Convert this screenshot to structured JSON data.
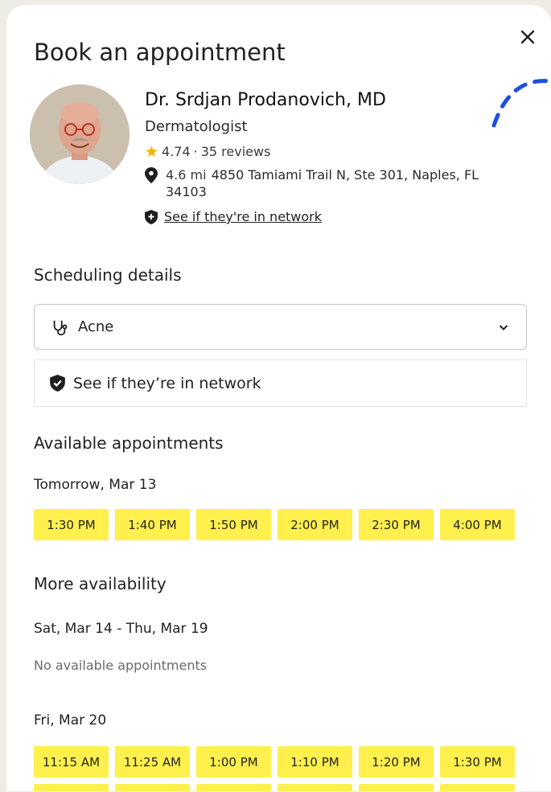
{
  "modal": {
    "title": "Book an appointment"
  },
  "doctor": {
    "name": "Dr. Srdjan Prodanovich, MD",
    "specialty": "Dermatologist",
    "rating": "4.74",
    "reviews": "35 reviews",
    "distance": "4.6 mi",
    "address": "4850 Tamiami Trail N, Ste 301, Naples, FL 34103",
    "network_link": "See if they're in network"
  },
  "scheduling": {
    "heading": "Scheduling details",
    "reason_value": "Acne",
    "network_box": "See if they’re in network"
  },
  "appointments": {
    "heading": "Available appointments",
    "tomorrow_label": "Tomorrow, Mar 13",
    "tomorrow_slots": [
      "1:30 PM",
      "1:40 PM",
      "1:50 PM",
      "2:00 PM",
      "2:30 PM",
      "4:00 PM"
    ]
  },
  "more": {
    "heading": "More availability",
    "range_label": "Sat, Mar 14 - Thu, Mar 19",
    "range_empty": "No available appointments",
    "fri_label": "Fri, Mar 20",
    "fri_slots": [
      "11:15 AM",
      "11:25 AM",
      "1:00 PM",
      "1:10 PM",
      "1:20 PM",
      "1:30 PM"
    ]
  },
  "colors": {
    "slot": "#fff04d",
    "star": "#f5b400",
    "dashed": "#1d4fe0"
  }
}
